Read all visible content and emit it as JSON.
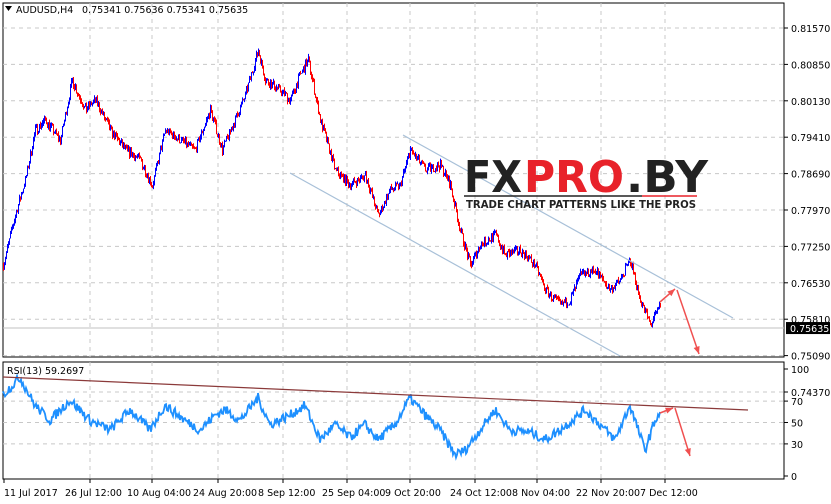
{
  "header": {
    "symbol": "AUDUSD,H4",
    "ohlc": "0.75341 0.75636 0.75341 0.75635"
  },
  "logo": {
    "brand_dark1": "FX",
    "brand_red": "PRO",
    "brand_dark2": ".BY",
    "tagline": "TRADE CHART PATTERNS LIKE THE PROS"
  },
  "colors": {
    "bull": "#0000ff",
    "bear": "#ff0000",
    "rsi": "#1e90ff",
    "channel": "#a8c0d8",
    "arrow": "#f05050",
    "rsi_trend": "#8b3a3a"
  },
  "chart_data": [
    {
      "type": "candlestick",
      "title": "AUDUSD,H4",
      "current_price": "0.75635",
      "ylim": [
        0.7437,
        0.8157
      ],
      "y_ticks": [
        "0.81570",
        "0.80850",
        "0.80130",
        "0.79410",
        "0.78690",
        "0.77970",
        "0.77250",
        "0.76530",
        "0.75810",
        "0.75090",
        "0.74370"
      ],
      "x_ticks": [
        "11 Jul 2017",
        "26 Jul 12:00",
        "10 Aug 04:00",
        "24 Aug 20:00",
        "8 Sep 12:00",
        "25 Sep 04:00",
        "9 Oct 20:00",
        "24 Oct 12:00",
        "8 Nov 04:00",
        "22 Nov 20:00",
        "7 Dec 12:00"
      ],
      "close_keypoints_bar_price": [
        [
          0,
          0.7688
        ],
        [
          12,
          0.7787
        ],
        [
          22,
          0.7856
        ],
        [
          32,
          0.7955
        ],
        [
          42,
          0.7975
        ],
        [
          57,
          0.7935
        ],
        [
          69,
          0.8054
        ],
        [
          82,
          0.7995
        ],
        [
          92,
          0.8015
        ],
        [
          107,
          0.7955
        ],
        [
          122,
          0.7916
        ],
        [
          137,
          0.7896
        ],
        [
          149,
          0.7846
        ],
        [
          162,
          0.7955
        ],
        [
          177,
          0.7935
        ],
        [
          192,
          0.7916
        ],
        [
          207,
          0.7995
        ],
        [
          219,
          0.7916
        ],
        [
          232,
          0.7975
        ],
        [
          242,
          0.8024
        ],
        [
          255,
          0.8113
        ],
        [
          262,
          0.8054
        ],
        [
          277,
          0.8034
        ],
        [
          287,
          0.8015
        ],
        [
          297,
          0.8064
        ],
        [
          305,
          0.8094
        ],
        [
          317,
          0.7975
        ],
        [
          332,
          0.7876
        ],
        [
          347,
          0.7846
        ],
        [
          362,
          0.7866
        ],
        [
          375,
          0.7787
        ],
        [
          387,
          0.7836
        ],
        [
          397,
          0.7846
        ],
        [
          407,
          0.7916
        ],
        [
          422,
          0.7876
        ],
        [
          437,
          0.7886
        ],
        [
          447,
          0.7846
        ],
        [
          457,
          0.7757
        ],
        [
          467,
          0.7688
        ],
        [
          477,
          0.7728
        ],
        [
          492,
          0.7748
        ],
        [
          502,
          0.7708
        ],
        [
          517,
          0.7718
        ],
        [
          532,
          0.7688
        ],
        [
          542,
          0.7639
        ],
        [
          557,
          0.7609
        ],
        [
          567,
          0.7619
        ],
        [
          577,
          0.7668
        ],
        [
          592,
          0.7678
        ],
        [
          607,
          0.7639
        ],
        [
          617,
          0.7659
        ],
        [
          627,
          0.7698
        ],
        [
          637,
          0.7619
        ],
        [
          647,
          0.757
        ],
        [
          657,
          0.7609
        ]
      ]
    },
    {
      "type": "line",
      "title": "RSI(13) 59.2697",
      "ylim": [
        0,
        100
      ],
      "y_ticks": [
        "100",
        "70",
        "50",
        "30",
        "0"
      ],
      "keypoints_bar_value": [
        [
          0,
          76
        ],
        [
          17,
          92
        ],
        [
          32,
          66
        ],
        [
          47,
          52
        ],
        [
          67,
          71
        ],
        [
          87,
          52
        ],
        [
          107,
          43
        ],
        [
          127,
          62
        ],
        [
          147,
          43
        ],
        [
          162,
          66
        ],
        [
          182,
          52
        ],
        [
          197,
          43
        ],
        [
          212,
          57
        ],
        [
          222,
          62
        ],
        [
          237,
          52
        ],
        [
          255,
          73
        ],
        [
          267,
          48
        ],
        [
          287,
          57
        ],
        [
          302,
          66
        ],
        [
          317,
          34
        ],
        [
          332,
          48
        ],
        [
          347,
          36
        ],
        [
          362,
          48
        ],
        [
          375,
          34
        ],
        [
          392,
          48
        ],
        [
          407,
          73
        ],
        [
          422,
          57
        ],
        [
          437,
          43
        ],
        [
          452,
          20
        ],
        [
          462,
          24
        ],
        [
          477,
          43
        ],
        [
          492,
          62
        ],
        [
          507,
          43
        ],
        [
          527,
          41
        ],
        [
          542,
          34
        ],
        [
          557,
          43
        ],
        [
          572,
          54
        ],
        [
          582,
          62
        ],
        [
          597,
          48
        ],
        [
          612,
          34
        ],
        [
          627,
          66
        ],
        [
          642,
          24
        ],
        [
          652,
          52
        ],
        [
          657,
          59
        ]
      ]
    }
  ]
}
